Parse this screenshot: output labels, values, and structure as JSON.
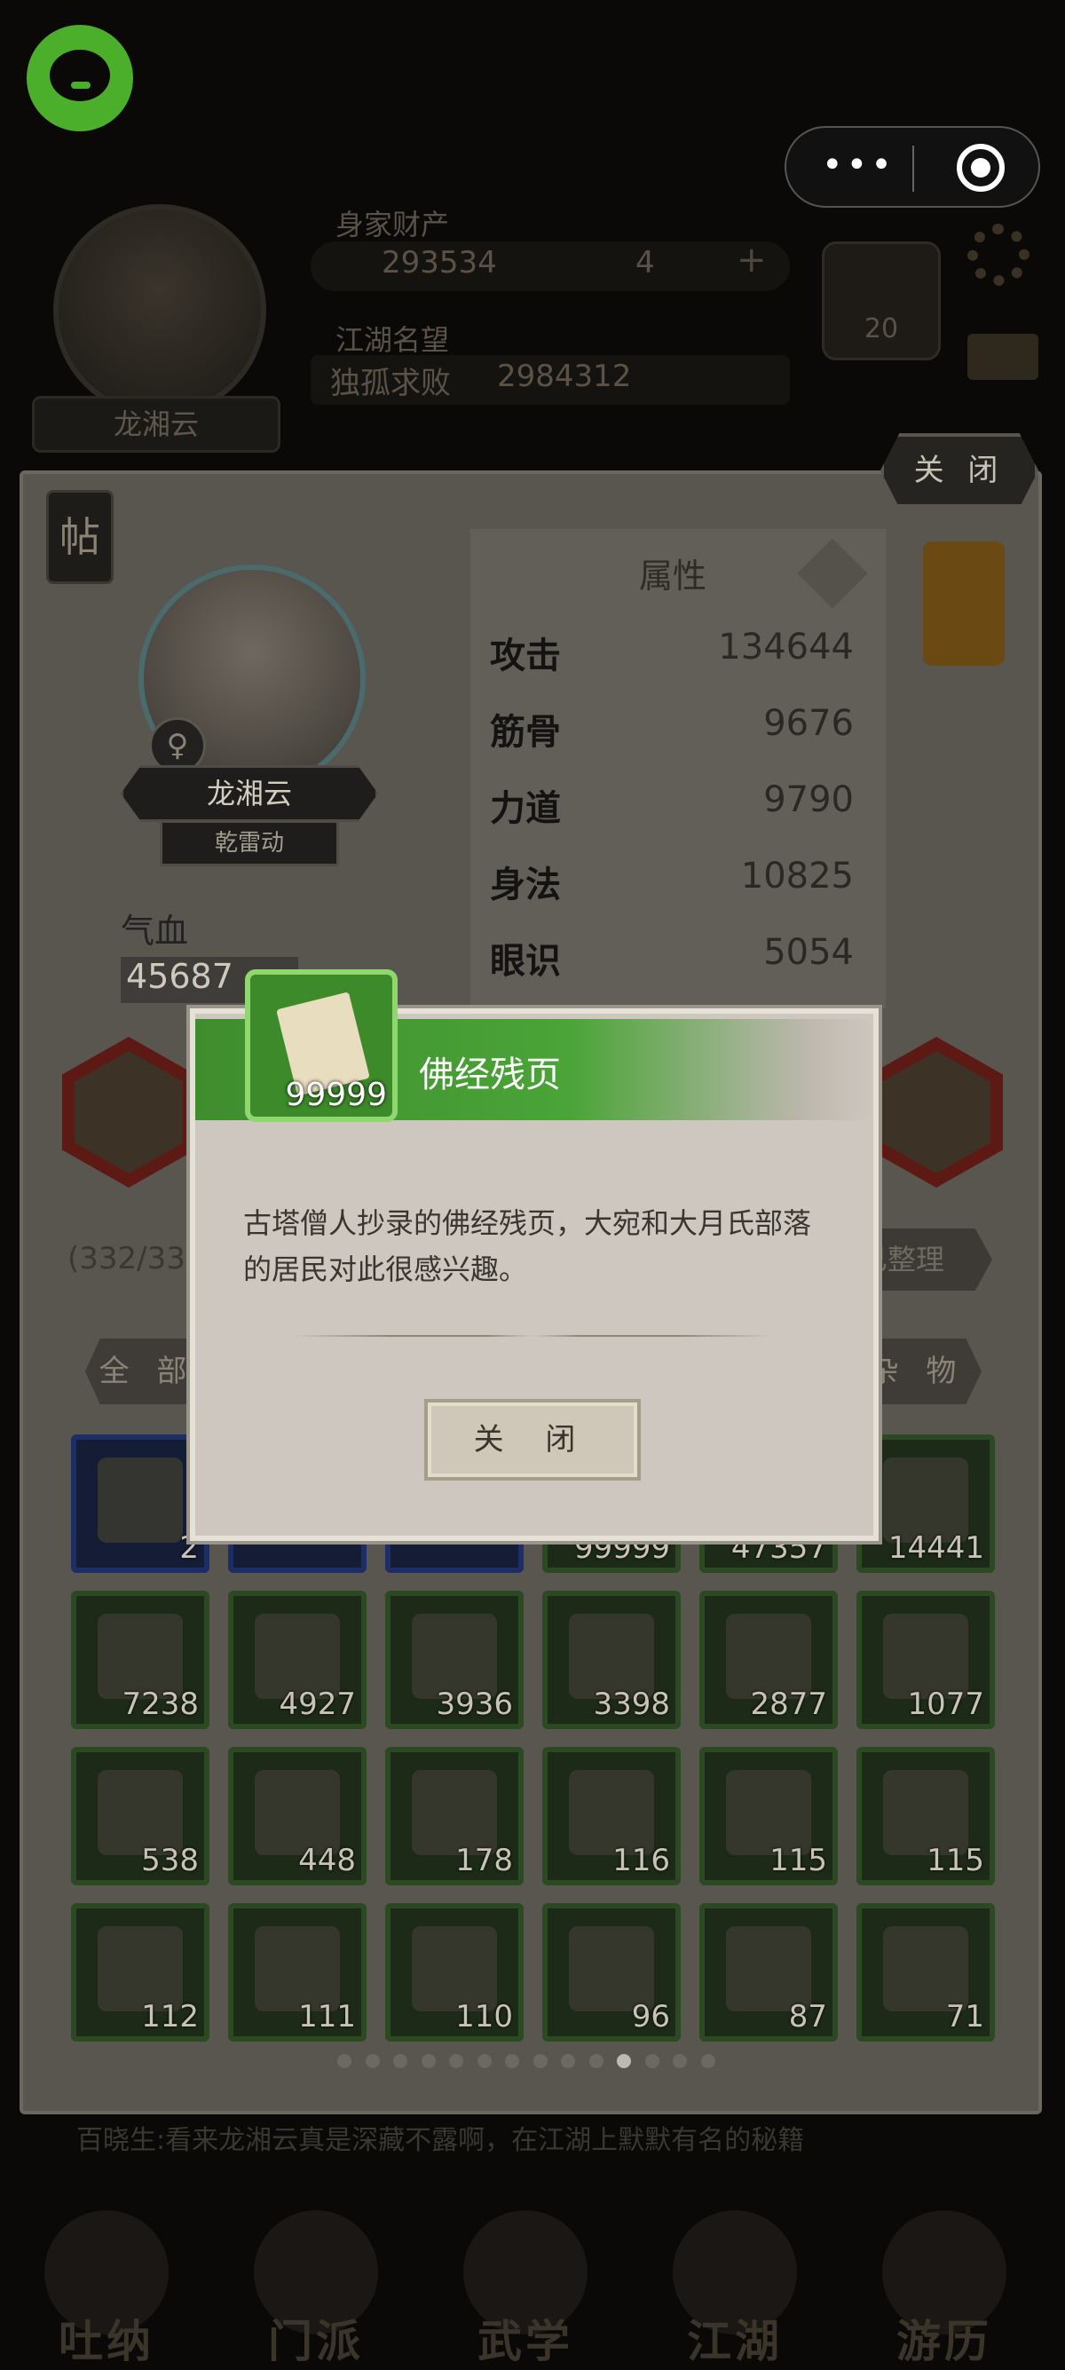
{
  "header": {
    "wealth_label": "身家财产",
    "gold": "293534",
    "tickets": "4",
    "plus": "+",
    "fame_label": "江湖名望",
    "fame_title": "独孤求败",
    "fame_value": "2984312",
    "level": "20",
    "name": "龙湘云"
  },
  "panel": {
    "close_label": "关 闭",
    "post_tag": "帖",
    "character_name": "龙湘云",
    "sect": "乾雷动",
    "gender_symbol": "♀",
    "hp_label": "气血",
    "hp_value": "45687",
    "attr_title": "属性",
    "attributes": [
      {
        "k": "攻击",
        "v": "134644"
      },
      {
        "k": "筋骨",
        "v": "9676"
      },
      {
        "k": "力道",
        "v": "9790"
      },
      {
        "k": "身法",
        "v": "10825"
      },
      {
        "k": "眼识",
        "v": "5054"
      }
    ],
    "capacity": "(332/33",
    "sort_label": "已整理",
    "tab_all": "全 部",
    "tab_misc": "杂 物",
    "news": "百晓生:看来龙湘云真是深藏不露啊，在江湖上默默有名的秘籍 "
  },
  "inventory": [
    [
      "2",
      "",
      "",
      "99999",
      "47357",
      "14441"
    ],
    [
      "7238",
      "4927",
      "3936",
      "3398",
      "2877",
      "1077"
    ],
    [
      "538",
      "448",
      "178",
      "116",
      "115",
      "115"
    ],
    [
      "112",
      "111",
      "110",
      "96",
      "87",
      "71"
    ]
  ],
  "pager": {
    "count": 14,
    "active": 10
  },
  "bottom_nav": [
    "吐纳",
    "门派",
    "武学",
    "江湖",
    "游历"
  ],
  "modal": {
    "item_name": "佛经残页",
    "item_count": "99999",
    "description": "古塔僧人抄录的佛经残页，大宛和大月氏部落的居民对此很感兴趣。",
    "close_label": "关 闭"
  },
  "colors": {
    "accent_green": "#4aa437",
    "item_border_green": "#8fd86e",
    "wechat_green": "#4caf2c"
  }
}
